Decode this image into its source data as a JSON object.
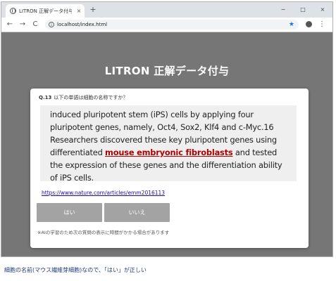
{
  "browser": {
    "tab_title": "LITRON 正解データ付与",
    "tab_close": "×",
    "new_tab": "+",
    "window_controls": {
      "minimize": "−",
      "maximize": "□",
      "close": "×"
    },
    "nav": {
      "back": "←",
      "forward": "→",
      "reload": "C"
    },
    "url": "localhost/index.html",
    "info_glyph": "i",
    "star_glyph": "★",
    "menu_glyph": "⋮"
  },
  "app": {
    "title": "LITRON 正解データ付与",
    "question": {
      "number": "Q.13",
      "text": "以下の単語は細胞の名称ですか？"
    },
    "passage": {
      "before": "induced pluripotent stem (iPS) cells by applying four pluripotent genes, namely, Oct4, Sox2, Klf4 and c-Myc.16 Researchers discovered these key pluripotent genes using differentiated ",
      "highlight": "mouse embryonic fibroblasts",
      "after": " and tested the expression of these genes and the differentiation ability of iPS cells."
    },
    "source_url": "https://www.nature.com/articles/emm2016113",
    "buttons": {
      "yes": "はい",
      "no": "いいえ"
    },
    "note": "※AIの学習のため次の質問の表示に時間がかかる場合があります"
  },
  "caption": "細胞の名前(マウス繊維芽細胞)なので、「はい」が正しい",
  "colors": {
    "page_background": "#767676",
    "highlight": "#b00000",
    "button": "#a3a3a3",
    "link": "#1a0dab",
    "caption": "#1f3a78"
  }
}
